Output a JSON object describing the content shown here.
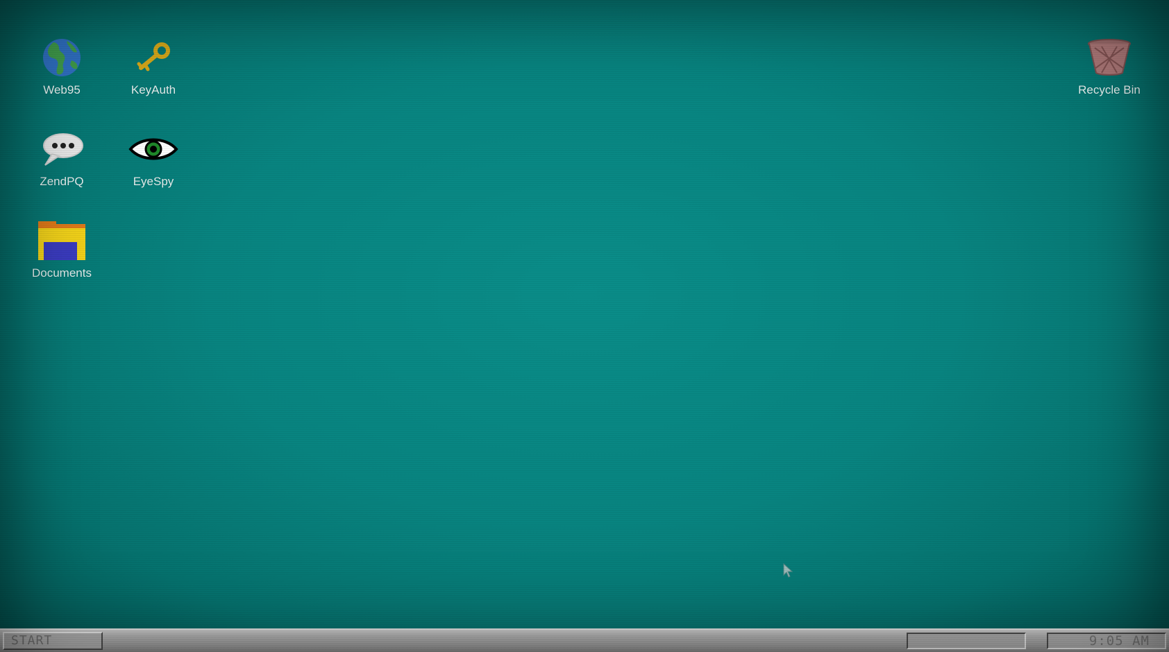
{
  "desktop": {
    "background_color": "#088682",
    "icons": [
      {
        "id": "web95",
        "label": "Web95",
        "icon": "globe-icon"
      },
      {
        "id": "keyauth",
        "label": "KeyAuth",
        "icon": "key-icon"
      },
      {
        "id": "zendpq",
        "label": "ZendPQ",
        "icon": "speech-bubble-icon"
      },
      {
        "id": "eyespy",
        "label": "EyeSpy",
        "icon": "eye-icon"
      },
      {
        "id": "documents",
        "label": "Documents",
        "icon": "folder-icon"
      },
      {
        "id": "recycle",
        "label": "Recycle Bin",
        "icon": "recycle-bin-icon"
      }
    ]
  },
  "taskbar": {
    "start_label": "START",
    "clock": "9:05 AM"
  }
}
